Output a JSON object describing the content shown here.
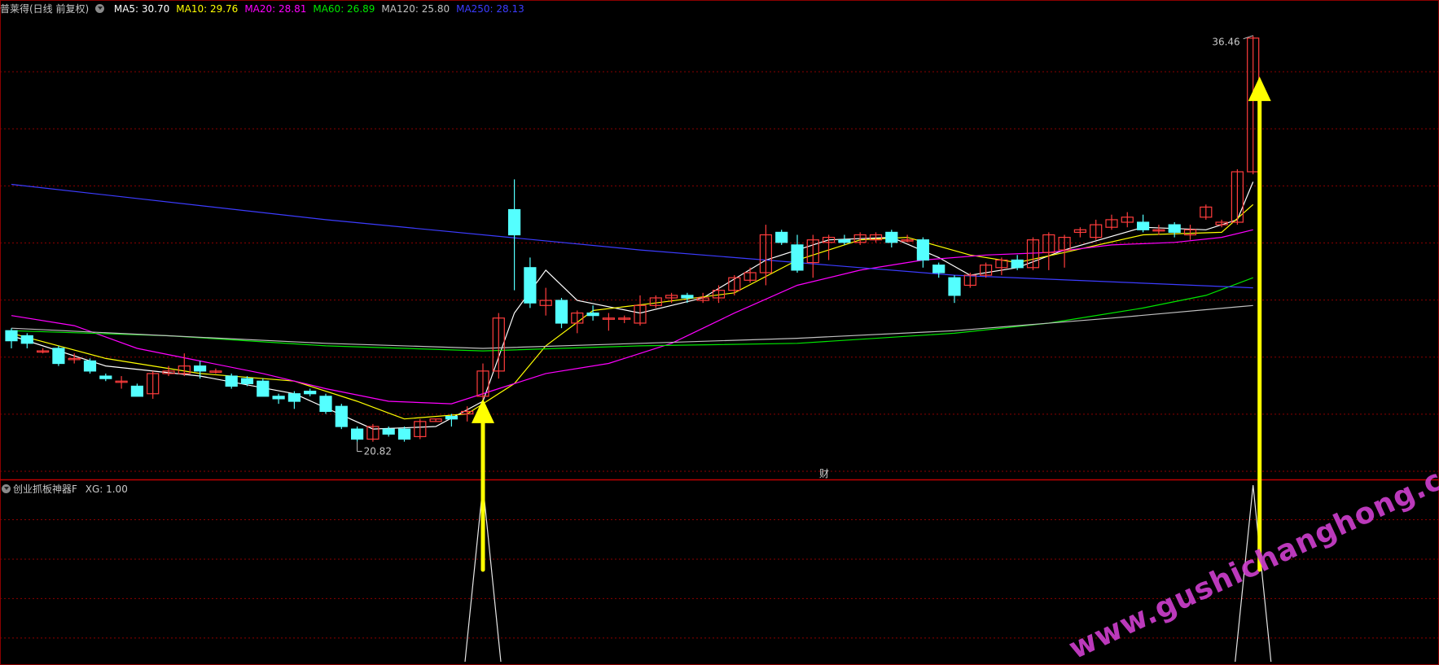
{
  "header": {
    "title": "普莱得(日线 前复权)",
    "ma_labels": [
      {
        "text": "MA5: 30.70",
        "color": "#ffffff"
      },
      {
        "text": "MA10: 29.76",
        "color": "#ffff00"
      },
      {
        "text": "MA20: 28.81",
        "color": "#ff00ff"
      },
      {
        "text": "MA60: 26.89",
        "color": "#00e600"
      },
      {
        "text": "MA120: 25.80",
        "color": "#c0c0c0"
      },
      {
        "text": "MA250: 28.13",
        "color": "#3c3cff"
      }
    ]
  },
  "sub_panel": {
    "title": "创业抓板神器F",
    "value_text": "XG: 1.00"
  },
  "annotations": {
    "high_label": "36.46",
    "low_label": "20.82",
    "fin_marker": "财",
    "watermark": "www.gushichanghong.com"
  },
  "colors": {
    "up": "#ff3c3c",
    "down": "#54ffff",
    "grid": "#8b0000",
    "arrow": "#ffff00",
    "watermark": "#d040d0",
    "xg": "#e6e6e6"
  },
  "chart_data": {
    "type": "candlestick",
    "title": "普莱得(日线 前复权)",
    "y_range": [
      19.0,
      37.2
    ],
    "candles": [
      {
        "o": 24.8,
        "c": 24.4,
        "h": 24.9,
        "l": 24.1
      },
      {
        "o": 24.6,
        "c": 24.3,
        "h": 24.7,
        "l": 24.1
      },
      {
        "o": 24.0,
        "c": 24.0,
        "h": 24.1,
        "l": 23.9
      },
      {
        "o": 24.1,
        "c": 23.5,
        "h": 24.2,
        "l": 23.4
      },
      {
        "o": 23.7,
        "c": 23.7,
        "h": 23.9,
        "l": 23.5
      },
      {
        "o": 23.6,
        "c": 23.2,
        "h": 23.7,
        "l": 23.1
      },
      {
        "o": 23.0,
        "c": 22.9,
        "h": 23.1,
        "l": 22.8
      },
      {
        "o": 22.8,
        "c": 22.8,
        "h": 23.0,
        "l": 22.5
      },
      {
        "o": 22.6,
        "c": 22.2,
        "h": 22.7,
        "l": 22.2
      },
      {
        "o": 22.3,
        "c": 23.1,
        "h": 23.2,
        "l": 22.1
      },
      {
        "o": 23.1,
        "c": 23.2,
        "h": 23.4,
        "l": 23.0
      },
      {
        "o": 23.1,
        "c": 23.4,
        "h": 23.9,
        "l": 23.0
      },
      {
        "o": 23.4,
        "c": 23.2,
        "h": 23.6,
        "l": 22.9
      },
      {
        "o": 23.2,
        "c": 23.2,
        "h": 23.3,
        "l": 23.1
      },
      {
        "o": 23.0,
        "c": 22.6,
        "h": 23.1,
        "l": 22.5
      },
      {
        "o": 22.9,
        "c": 22.7,
        "h": 23.0,
        "l": 22.6
      },
      {
        "o": 22.8,
        "c": 22.2,
        "h": 22.9,
        "l": 22.2
      },
      {
        "o": 22.2,
        "c": 22.1,
        "h": 22.3,
        "l": 21.9
      },
      {
        "o": 22.3,
        "c": 22.0,
        "h": 22.4,
        "l": 21.7
      },
      {
        "o": 22.4,
        "c": 22.3,
        "h": 22.5,
        "l": 22.2
      },
      {
        "o": 22.2,
        "c": 21.6,
        "h": 22.3,
        "l": 21.5
      },
      {
        "o": 21.8,
        "c": 21.0,
        "h": 21.9,
        "l": 20.9
      },
      {
        "o": 20.9,
        "c": 20.5,
        "h": 21.0,
        "l": 20.4
      },
      {
        "o": 20.5,
        "c": 21.0,
        "h": 21.1,
        "l": 20.4
      },
      {
        "o": 20.9,
        "c": 20.7,
        "h": 21.0,
        "l": 20.6
      },
      {
        "o": 20.9,
        "c": 20.5,
        "h": 21.0,
        "l": 20.4
      },
      {
        "o": 20.6,
        "c": 21.2,
        "h": 21.3,
        "l": 20.5
      },
      {
        "o": 21.2,
        "c": 21.3,
        "h": 21.3,
        "l": 21.2
      },
      {
        "o": 21.4,
        "c": 21.3,
        "h": 21.5,
        "l": 21.0
      },
      {
        "o": 21.5,
        "c": 21.6,
        "h": 21.8,
        "l": 21.2
      },
      {
        "o": 22.2,
        "c": 23.2,
        "h": 23.5,
        "l": 22.1
      },
      {
        "o": 23.2,
        "c": 25.3,
        "h": 25.5,
        "l": 22.9
      },
      {
        "o": 29.6,
        "c": 28.6,
        "h": 30.8,
        "l": 26.4
      },
      {
        "o": 27.3,
        "c": 25.9,
        "h": 27.7,
        "l": 25.7
      },
      {
        "o": 25.8,
        "c": 26.0,
        "h": 26.5,
        "l": 25.4
      },
      {
        "o": 26.0,
        "c": 25.1,
        "h": 26.1,
        "l": 24.9
      },
      {
        "o": 25.1,
        "c": 25.5,
        "h": 25.6,
        "l": 24.7
      },
      {
        "o": 25.5,
        "c": 25.4,
        "h": 25.8,
        "l": 25.2
      },
      {
        "o": 25.3,
        "c": 25.3,
        "h": 25.5,
        "l": 24.8
      },
      {
        "o": 25.3,
        "c": 25.3,
        "h": 25.4,
        "l": 25.1
      },
      {
        "o": 25.1,
        "c": 25.8,
        "h": 26.2,
        "l": 25.0
      },
      {
        "o": 25.8,
        "c": 26.1,
        "h": 26.2,
        "l": 25.7
      },
      {
        "o": 26.1,
        "c": 26.2,
        "h": 26.3,
        "l": 25.9
      },
      {
        "o": 26.2,
        "c": 26.1,
        "h": 26.3,
        "l": 25.9
      },
      {
        "o": 26.0,
        "c": 26.1,
        "h": 26.3,
        "l": 25.9
      },
      {
        "o": 26.1,
        "c": 26.4,
        "h": 26.6,
        "l": 25.9
      },
      {
        "o": 26.4,
        "c": 26.9,
        "h": 27.0,
        "l": 26.2
      },
      {
        "o": 26.8,
        "c": 27.1,
        "h": 27.3,
        "l": 26.7
      },
      {
        "o": 27.1,
        "c": 28.6,
        "h": 29.0,
        "l": 26.6
      },
      {
        "o": 28.7,
        "c": 28.3,
        "h": 28.8,
        "l": 28.2
      },
      {
        "o": 28.2,
        "c": 27.2,
        "h": 28.6,
        "l": 27.1
      },
      {
        "o": 27.5,
        "c": 28.4,
        "h": 28.6,
        "l": 26.9
      },
      {
        "o": 28.3,
        "c": 28.5,
        "h": 28.6,
        "l": 27.6
      },
      {
        "o": 28.4,
        "c": 28.3,
        "h": 28.6,
        "l": 28.2
      },
      {
        "o": 28.3,
        "c": 28.6,
        "h": 28.7,
        "l": 28.2
      },
      {
        "o": 28.4,
        "c": 28.6,
        "h": 28.7,
        "l": 28.3
      },
      {
        "o": 28.7,
        "c": 28.3,
        "h": 28.8,
        "l": 28.1
      },
      {
        "o": 28.4,
        "c": 28.4,
        "h": 28.6,
        "l": 28.3
      },
      {
        "o": 28.4,
        "c": 27.6,
        "h": 28.5,
        "l": 27.3
      },
      {
        "o": 27.4,
        "c": 27.1,
        "h": 27.5,
        "l": 26.9
      },
      {
        "o": 26.9,
        "c": 26.2,
        "h": 27.0,
        "l": 25.9
      },
      {
        "o": 26.6,
        "c": 27.0,
        "h": 27.1,
        "l": 26.5
      },
      {
        "o": 27.0,
        "c": 27.4,
        "h": 27.5,
        "l": 26.9
      },
      {
        "o": 27.3,
        "c": 27.6,
        "h": 27.7,
        "l": 27.0
      },
      {
        "o": 27.6,
        "c": 27.3,
        "h": 27.8,
        "l": 27.2
      },
      {
        "o": 27.3,
        "c": 28.4,
        "h": 28.5,
        "l": 27.2
      },
      {
        "o": 27.9,
        "c": 28.6,
        "h": 28.7,
        "l": 27.2
      },
      {
        "o": 28.0,
        "c": 28.5,
        "h": 28.6,
        "l": 27.3
      },
      {
        "o": 28.7,
        "c": 28.8,
        "h": 28.9,
        "l": 28.5
      },
      {
        "o": 28.5,
        "c": 29.0,
        "h": 29.2,
        "l": 28.4
      },
      {
        "o": 28.9,
        "c": 29.2,
        "h": 29.4,
        "l": 28.8
      },
      {
        "o": 29.1,
        "c": 29.3,
        "h": 29.5,
        "l": 28.9
      },
      {
        "o": 29.1,
        "c": 28.8,
        "h": 29.4,
        "l": 28.7
      },
      {
        "o": 28.8,
        "c": 28.8,
        "h": 29.0,
        "l": 28.6
      },
      {
        "o": 29.0,
        "c": 28.7,
        "h": 29.1,
        "l": 28.5
      },
      {
        "o": 28.6,
        "c": 28.8,
        "h": 29.0,
        "l": 28.4
      },
      {
        "o": 29.3,
        "c": 29.7,
        "h": 29.8,
        "l": 29.2
      },
      {
        "o": 29.0,
        "c": 29.1,
        "h": 29.2,
        "l": 28.9
      },
      {
        "o": 29.1,
        "c": 31.1,
        "h": 31.2,
        "l": 29.0
      },
      {
        "o": 31.1,
        "c": 36.4,
        "h": 36.5,
        "l": 31.0
      }
    ],
    "ma_lines": [
      {
        "name": "MA5",
        "color": "#ffffff",
        "points": [
          [
            0,
            24.6
          ],
          [
            6,
            23.4
          ],
          [
            12,
            23.0
          ],
          [
            18,
            22.3
          ],
          [
            23,
            20.9
          ],
          [
            27,
            21.0
          ],
          [
            30,
            22.0
          ],
          [
            32,
            25.5
          ],
          [
            34,
            27.2
          ],
          [
            36,
            26.0
          ],
          [
            40,
            25.5
          ],
          [
            44,
            26.1
          ],
          [
            48,
            27.6
          ],
          [
            52,
            28.4
          ],
          [
            56,
            28.5
          ],
          [
            59,
            27.7
          ],
          [
            61,
            27.0
          ],
          [
            64,
            27.3
          ],
          [
            67,
            28.0
          ],
          [
            72,
            28.9
          ],
          [
            76,
            28.8
          ],
          [
            78,
            29.2
          ],
          [
            79,
            30.7
          ]
        ]
      },
      {
        "name": "MA10",
        "color": "#ffff00",
        "points": [
          [
            0,
            24.7
          ],
          [
            6,
            23.7
          ],
          [
            12,
            23.1
          ],
          [
            18,
            22.8
          ],
          [
            22,
            22.0
          ],
          [
            25,
            21.3
          ],
          [
            29,
            21.5
          ],
          [
            32,
            22.7
          ],
          [
            34,
            24.2
          ],
          [
            37,
            25.6
          ],
          [
            41,
            25.9
          ],
          [
            46,
            26.3
          ],
          [
            50,
            27.6
          ],
          [
            54,
            28.4
          ],
          [
            57,
            28.5
          ],
          [
            61,
            27.8
          ],
          [
            64,
            27.5
          ],
          [
            67,
            27.9
          ],
          [
            72,
            28.6
          ],
          [
            77,
            28.7
          ],
          [
            79,
            29.8
          ]
        ]
      },
      {
        "name": "MA20",
        "color": "#ff00ff",
        "points": [
          [
            0,
            25.4
          ],
          [
            4,
            25.0
          ],
          [
            8,
            24.1
          ],
          [
            12,
            23.6
          ],
          [
            16,
            23.1
          ],
          [
            20,
            22.5
          ],
          [
            24,
            22.0
          ],
          [
            28,
            21.9
          ],
          [
            31,
            22.5
          ],
          [
            34,
            23.1
          ],
          [
            38,
            23.5
          ],
          [
            42,
            24.3
          ],
          [
            46,
            25.5
          ],
          [
            50,
            26.6
          ],
          [
            54,
            27.2
          ],
          [
            58,
            27.6
          ],
          [
            62,
            27.8
          ],
          [
            66,
            27.9
          ],
          [
            70,
            28.2
          ],
          [
            74,
            28.3
          ],
          [
            77,
            28.5
          ],
          [
            79,
            28.8
          ]
        ]
      },
      {
        "name": "MA60",
        "color": "#00e600",
        "points": [
          [
            0,
            24.8
          ],
          [
            10,
            24.6
          ],
          [
            20,
            24.2
          ],
          [
            30,
            24.0
          ],
          [
            40,
            24.2
          ],
          [
            50,
            24.3
          ],
          [
            60,
            24.7
          ],
          [
            66,
            25.1
          ],
          [
            72,
            25.7
          ],
          [
            76,
            26.2
          ],
          [
            79,
            26.9
          ]
        ]
      },
      {
        "name": "MA120",
        "color": "#c0c0c0",
        "points": [
          [
            0,
            24.9
          ],
          [
            10,
            24.6
          ],
          [
            20,
            24.3
          ],
          [
            30,
            24.1
          ],
          [
            40,
            24.3
          ],
          [
            50,
            24.5
          ],
          [
            60,
            24.8
          ],
          [
            70,
            25.3
          ],
          [
            79,
            25.8
          ]
        ]
      },
      {
        "name": "MA250",
        "color": "#3c3cff",
        "points": [
          [
            0,
            30.6
          ],
          [
            20,
            29.2
          ],
          [
            40,
            28.0
          ],
          [
            60,
            27.0
          ],
          [
            79,
            26.5
          ]
        ]
      }
    ],
    "xg_signal": {
      "values_at": [
        30,
        79
      ],
      "value": 1.0
    },
    "signal_arrows": [
      30,
      79
    ]
  }
}
